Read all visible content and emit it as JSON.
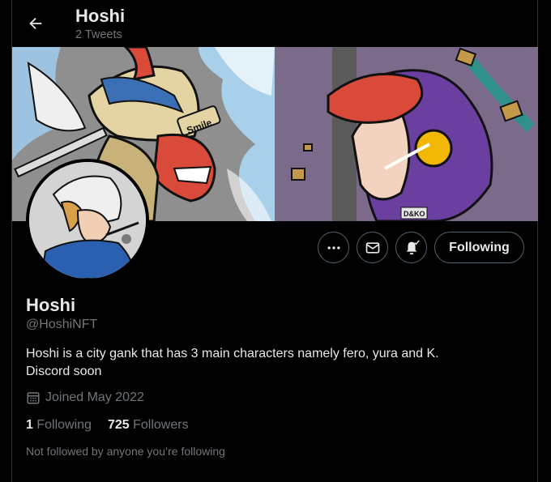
{
  "header": {
    "title": "Hoshi",
    "subtitle": "2 Tweets",
    "back_icon": "arrow-left-icon"
  },
  "banner": {
    "sign_text": "Smile",
    "tag_text": "D&KO"
  },
  "actions": {
    "more_icon": "more-dots-icon",
    "message_icon": "envelope-icon",
    "notify_icon": "bell-plus-icon",
    "follow_label": "Following"
  },
  "profile": {
    "name": "Hoshi",
    "handle": "@HoshiNFT",
    "bio_line1": "Hoshi is a city gank that has 3 main characters namely fero, yura and K.",
    "bio_line2": "Discord soon",
    "joined": "Joined May 2022",
    "calendar_icon": "calendar-icon",
    "following_count": "1",
    "following_label": "Following",
    "followers_count": "725",
    "followers_label": "Followers",
    "not_followed_text": "Not followed by anyone you’re following"
  },
  "colors": {
    "background": "#000000",
    "text": "#e7e9ea",
    "muted": "#71767b",
    "border": "#536471"
  }
}
